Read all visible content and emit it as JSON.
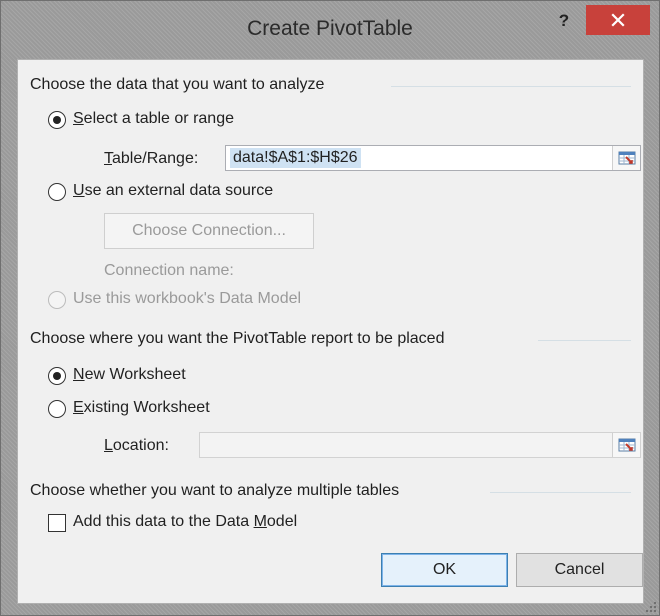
{
  "window": {
    "title": "Create PivotTable",
    "help_label": "?"
  },
  "section_data": {
    "heading": "Choose the data that you want to analyze",
    "select_table": {
      "label_accel": "S",
      "label_rest": "elect a table or range",
      "checked": true
    },
    "table_range": {
      "label_accel": "T",
      "label_rest": "able/Range:",
      "value": "data!$A$1:$H$26"
    },
    "external_source": {
      "label_accel": "U",
      "label_rest": "se an external data source",
      "checked": false
    },
    "choose_connection_label": "Choose Connection...",
    "connection_name_label": "Connection name:",
    "data_model": {
      "label": "Use this workbook's Data Model",
      "enabled": false
    }
  },
  "section_placement": {
    "heading": "Choose where you want the PivotTable report to be placed",
    "new_worksheet": {
      "label_accel": "N",
      "label_rest": "ew Worksheet",
      "checked": true
    },
    "existing_worksheet": {
      "label_accel": "E",
      "label_rest": "xisting Worksheet",
      "checked": false
    },
    "location": {
      "label_accel": "L",
      "label_rest": "ocation:",
      "value": ""
    }
  },
  "section_multi": {
    "heading": "Choose whether you want to analyze multiple tables",
    "add_to_model": {
      "label_pre": "Add this data to the Data ",
      "label_accel": "M",
      "label_post": "odel",
      "checked": false
    }
  },
  "buttons": {
    "ok": "OK",
    "cancel": "Cancel"
  },
  "colors": {
    "close_button": "#c8413b",
    "selection_highlight": "#cfe2f3",
    "primary_button_border": "#3c7fb1"
  },
  "icons": {
    "close": "close-icon",
    "range_picker": "range-picker-icon",
    "resize_grip": "resize-grip-icon"
  }
}
